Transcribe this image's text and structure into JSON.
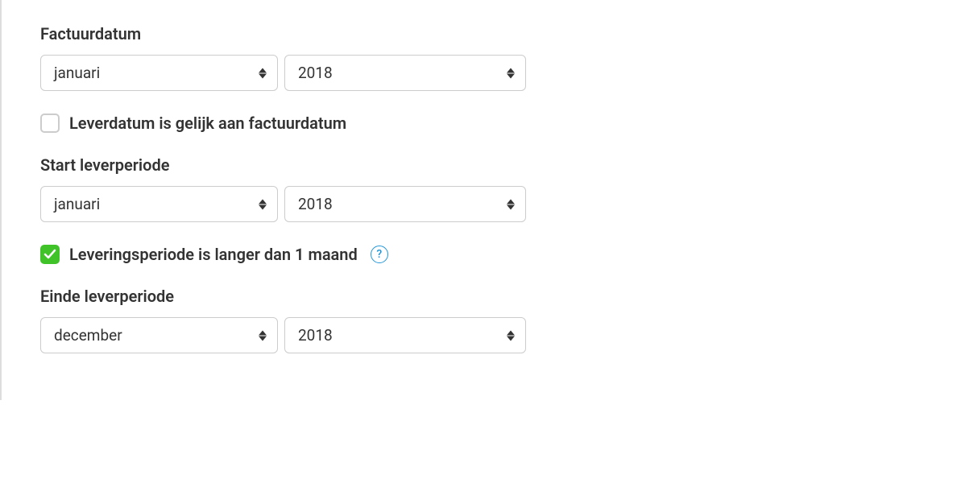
{
  "factuurdatum": {
    "label": "Factuurdatum",
    "month": "januari",
    "year": "2018"
  },
  "leverdatum_checkbox": {
    "label": "Leverdatum is gelijk aan factuurdatum",
    "checked": false
  },
  "start_leverperiode": {
    "label": "Start leverperiode",
    "month": "januari",
    "year": "2018"
  },
  "leveringsperiode_checkbox": {
    "label": "Leveringsperiode is langer dan 1 maand",
    "checked": true
  },
  "einde_leverperiode": {
    "label": "Einde leverperiode",
    "month": "december",
    "year": "2018"
  },
  "help_text": "?"
}
